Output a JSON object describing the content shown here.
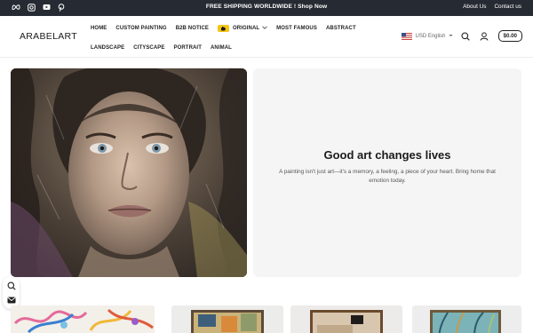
{
  "topbar": {
    "social_icons": [
      "meta-icon",
      "instagram-icon",
      "youtube-icon",
      "pinterest-icon"
    ],
    "promo": "FREE SHIPPING WORLDWIDE ! Shop Now",
    "links": [
      {
        "label": "About Us"
      },
      {
        "label": "Contact us"
      }
    ]
  },
  "header": {
    "logo": "ARABELART",
    "nav_row1": [
      {
        "label": "HOME"
      },
      {
        "label": "CUSTOM PAINTING"
      },
      {
        "label": "B2B NOTICE"
      },
      {
        "label": "ORIGINAL",
        "has_dropdown": true,
        "badge": "hand-icon"
      },
      {
        "label": "MOST FAMOUS"
      },
      {
        "label": "ABSTRACT"
      }
    ],
    "nav_row2": [
      {
        "label": "LANDSCAPE"
      },
      {
        "label": "CITYSCAPE"
      },
      {
        "label": "PORTRAIT"
      },
      {
        "label": "ANIMAL"
      }
    ],
    "currency": "USD English",
    "cart": "$0.00"
  },
  "hero": {
    "title": "Good art changes lives",
    "subtitle_line1": "A painting isn't just art—it's a memory, a feeling, a piece of your heart. Bring home that",
    "subtitle_line2": "emotion today."
  },
  "colors": {
    "topbar_bg": "#262b33",
    "badge_yellow": "#f6c414",
    "panel_bg": "#f5f5f5"
  }
}
